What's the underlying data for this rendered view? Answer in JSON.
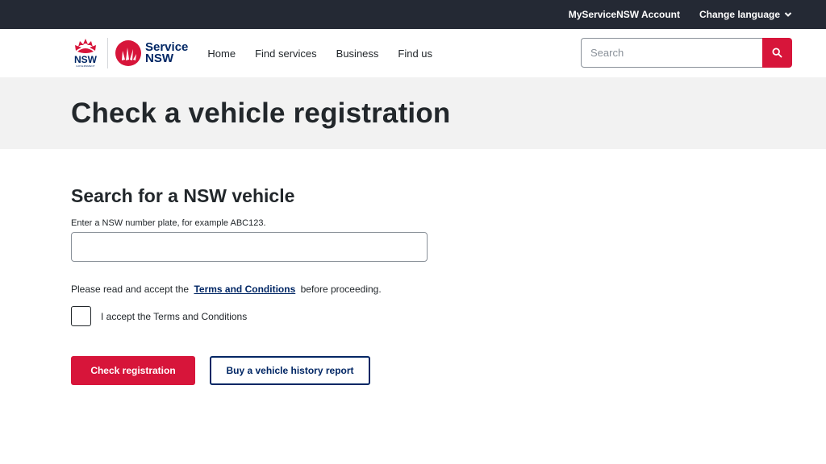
{
  "topbar": {
    "account_label": "MyServiceNSW Account",
    "language_label": "Change language"
  },
  "logos": {
    "nsw_label": "NSW",
    "nsw_sub": "GOVERNMENT",
    "service_line1": "Service",
    "service_line2": "NSW"
  },
  "nav": {
    "items": [
      {
        "label": "Home"
      },
      {
        "label": "Find services"
      },
      {
        "label": "Business"
      },
      {
        "label": "Find us"
      }
    ]
  },
  "search": {
    "placeholder": "Search"
  },
  "page": {
    "title": "Check a vehicle registration"
  },
  "form": {
    "heading": "Search for a NSW vehicle",
    "plate_hint": "Enter a NSW number plate, for example ABC123.",
    "plate_value": "",
    "terms_prefix": "Please read and accept the",
    "terms_link": "Terms and Conditions",
    "terms_suffix": "before proceeding.",
    "accept_label": "I accept the Terms and Conditions",
    "accept_checked": false,
    "check_button": "Check registration",
    "history_button": "Buy a vehicle history report"
  },
  "colors": {
    "brand_red": "#d7153a",
    "brand_navy": "#002664",
    "topbar_bg": "#242934",
    "hero_bg": "#f2f2f2"
  }
}
